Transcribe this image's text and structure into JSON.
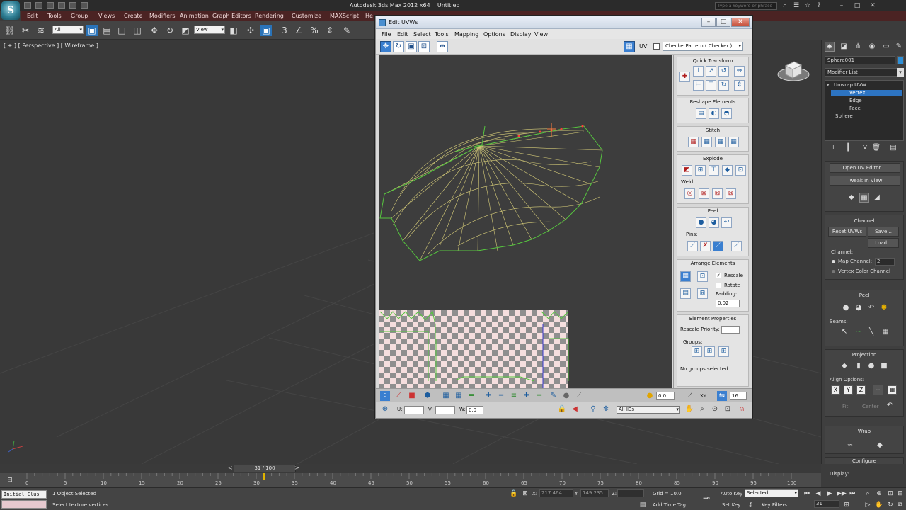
{
  "app": {
    "window_title": "Autodesk 3ds Max 2012 x64",
    "document": "Untitled",
    "search_placeholder": "Type a keyword or phrase",
    "logo": "S",
    "menu": [
      "Edit",
      "Tools",
      "Group",
      "Views",
      "Create",
      "Modifiers",
      "Animation",
      "Graph Editors",
      "Rendering",
      "Customize",
      "MAXScript",
      "He"
    ]
  },
  "toolbar": {
    "selection_filter": "All",
    "reference_coord": "View"
  },
  "viewport": {
    "label": "[ + ] [ Perspective ] [ Wireframe ]"
  },
  "uvw": {
    "title": "Edit UVWs",
    "menu": [
      "File",
      "Edit",
      "Select",
      "Tools",
      "Mapping",
      "Options",
      "Display",
      "View"
    ],
    "uv_label": "UV",
    "checker": "CheckerPattern  ( Checker )",
    "rollouts": {
      "quick_transform": "Quick Transform",
      "reshape": "Reshape Elements",
      "stitch": "Stitch",
      "explode": "Explode",
      "weld": "Weld",
      "peel": "Peel",
      "pins": "Pins:",
      "arrange": "Arrange Elements",
      "rescale": "Rescale",
      "rotate": "Rotate",
      "padding_label": "Padding:",
      "padding_value": "0.02",
      "element_props": "Element Properties",
      "rescale_priority": "Rescale Priority:",
      "groups": "Groups:",
      "no_groups": "No groups selected"
    },
    "bottom": {
      "angle_value": "0.0",
      "xy_label": "XY",
      "grid_value": "16",
      "u_label": "U:",
      "v_label": "V:",
      "w_label": "W:",
      "w_value": "0.0",
      "ids_dropdown": "All IDs"
    }
  },
  "cmd_panel": {
    "object_name": "Sphere001",
    "object_color": "#2e8fd6",
    "modifier_list": "Modifier List",
    "stack": [
      "Unwrap UVW",
      "Vertex",
      "Edge",
      "Face",
      "Sphere"
    ],
    "open_uv_editor": "Open UV Editor ...",
    "tweak_in_view": "Tweak In View",
    "channel_title": "Channel",
    "reset_uvws": "Reset UVWs",
    "save": "Save...",
    "load": "Load...",
    "channel_label": "Channel:",
    "map_channel": "Map Channel:",
    "map_channel_value": "2",
    "vertex_color_channel": "Vertex Color Channel",
    "peel_title": "Peel",
    "seams": "Seams:",
    "projection_title": "Projection",
    "align_options": "Align Options:",
    "align_x": "X",
    "align_y": "Y",
    "align_z": "Z",
    "fit": "Fit",
    "center": "Center",
    "wrap_title": "Wrap",
    "configure_title": "Configure",
    "display": "Display:"
  },
  "timeline": {
    "frame_counter": "31 / 100",
    "prev": "<",
    "next": ">",
    "ticks": [
      "0",
      "5",
      "10",
      "15",
      "20",
      "25",
      "30",
      "35",
      "40",
      "45",
      "50",
      "55",
      "60",
      "65",
      "70",
      "75",
      "80",
      "85",
      "90",
      "95",
      "100"
    ]
  },
  "status": {
    "maxscript": "Initial Clus",
    "objects_selected": "1 Object Selected",
    "prompt": "Select texture vertices",
    "x_label": "X:",
    "x_value": "217.464",
    "y_label": "Y:",
    "y_value": "149.235",
    "z_label": "Z:",
    "grid": "Grid = 10.0",
    "auto_key": "Auto Key",
    "selected_drop": "Selected",
    "set_key": "Set Key",
    "key_filters": "Key Filters...",
    "add_time_tag": "Add Time Tag",
    "current_frame": "31"
  }
}
